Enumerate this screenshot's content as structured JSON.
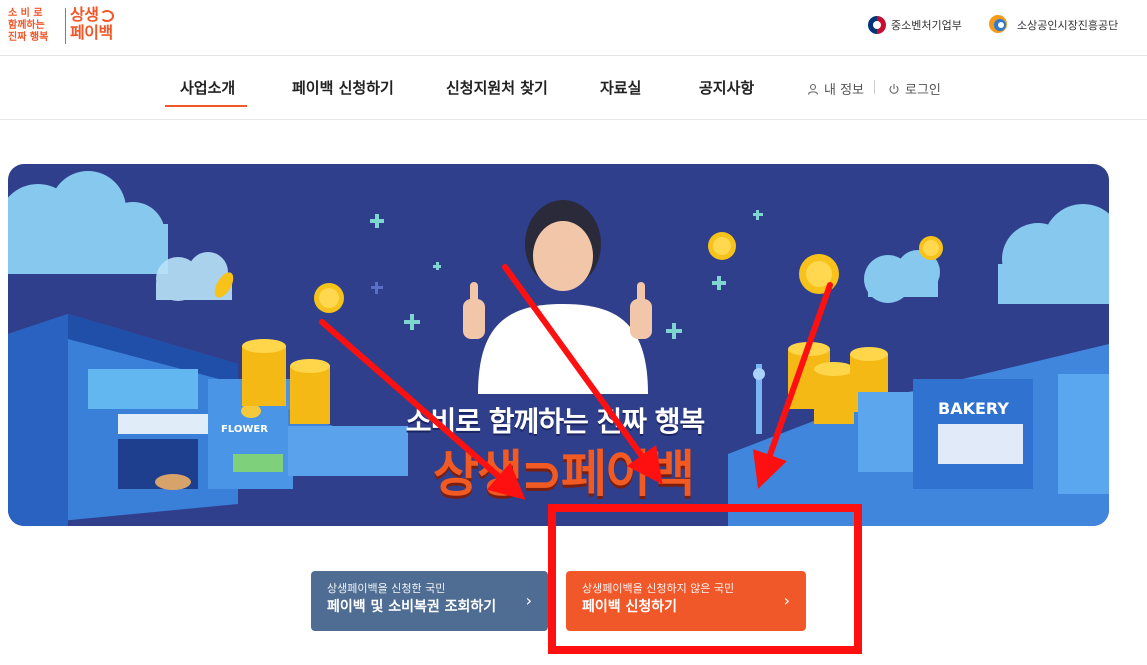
{
  "header": {
    "logo_slogan_line1": "소 비 로",
    "logo_slogan_line2": "함께하는",
    "logo_slogan_line3": "진짜 행복",
    "logo_brand_line1": "상생",
    "logo_brand_line2": "페이백",
    "org1_name": "중소벤처기업부",
    "org2_name": "소상공인시장진흥공단"
  },
  "nav": {
    "items": [
      {
        "label": "사업소개",
        "active": true
      },
      {
        "label": "페이백 신청하기",
        "active": false
      },
      {
        "label": "신청지원처 찾기",
        "active": false
      },
      {
        "label": "자료실",
        "active": false
      },
      {
        "label": "공지사항",
        "active": false
      }
    ],
    "my_info_label": "내 정보",
    "login_label": "로그인"
  },
  "banner": {
    "headline": "소비로 함께하는 진짜 행복",
    "brand": "상생⊃페이백",
    "sign_flower": "FLOWER",
    "sign_bakery": "BAKERY"
  },
  "cta": [
    {
      "sub": "상생페이백을 신청한 국민",
      "main": "페이백 및 소비복권 조회하기",
      "arrow": "›",
      "color": "#4f6d93"
    },
    {
      "sub": "상생페이백을 신청하지 않은 국민",
      "main": "페이백 신청하기",
      "arrow": "›",
      "color": "#f0582a"
    }
  ],
  "colors": {
    "accent": "#f0582a",
    "banner_bg": "#2f3f8c",
    "annotation": "#ff1010"
  }
}
